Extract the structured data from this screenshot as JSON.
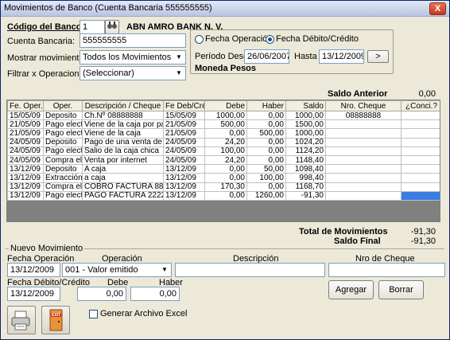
{
  "window": {
    "title": "Movimientos de Banco (Cuenta Bancaria 555555555)",
    "close_glyph": "X"
  },
  "filters": {
    "codigo_label": "Código del Banco:",
    "codigo_value": "1",
    "bank_name": "ABN AMRO BANK N. V.",
    "cuenta_label": "Cuenta Bancaria:",
    "cuenta_value": "555555555",
    "mostrar_label": "Mostrar movimientos:",
    "mostrar_value": "Todos los Movimientos",
    "filtrar_label": "Filtrar x Operacion:",
    "filtrar_value": "(Seleccionar)"
  },
  "period": {
    "radio_fecha_operacion": "Fecha Operación",
    "radio_fecha_debito": "Fecha Débito/Crédito",
    "selected_radio": "fecha_debito",
    "desde_label": "Período Desde",
    "desde_value": "26/06/2007",
    "hasta_label": "Hasta",
    "hasta_value": "13/12/2009",
    "go_label": ">",
    "moneda": "Moneda Pesos"
  },
  "saldo_anterior": {
    "label": "Saldo Anterior",
    "value": "0,00"
  },
  "table": {
    "columns": [
      "Fe. Oper.",
      "Oper.",
      "Descripción / Cheque",
      "Fe Deb/Cré",
      "Debe",
      "Haber",
      "Saldo",
      "Nro. Cheque",
      "¿Conci.?"
    ],
    "rows": [
      [
        "15/05/09",
        "Deposito",
        "Ch.Nº 08888888",
        "15/05/09",
        "1000,00",
        "0,00",
        "1000,00",
        "08888888",
        ""
      ],
      [
        "21/05/09",
        "Pago electró",
        "Viene de la caja por paso a",
        "21/05/09",
        "500,00",
        "0,00",
        "1500,00",
        "",
        ""
      ],
      [
        "21/05/09",
        "Pago electró",
        "Viene de la caja",
        "21/05/09",
        "0,00",
        "500,00",
        "1000,00",
        "",
        ""
      ],
      [
        "24/05/09",
        "Deposito",
        "Pago de una venta de una",
        "24/05/09",
        "24,20",
        "0,00",
        "1024,20",
        "",
        ""
      ],
      [
        "24/05/09",
        "Pago electró",
        "Salio de la caja chica",
        "24/05/09",
        "100,00",
        "0,00",
        "1124,20",
        "",
        ""
      ],
      [
        "24/05/09",
        "Compra elect",
        "Venta por internet",
        "24/05/09",
        "24,20",
        "0,00",
        "1148,40",
        "",
        ""
      ],
      [
        "13/12/09",
        "Deposito",
        "A caja",
        "13/12/09",
        "0,00",
        "50,00",
        "1098,40",
        "",
        ""
      ],
      [
        "13/12/09",
        "Extracción b",
        "a caja",
        "13/12/09",
        "0,00",
        "100,00",
        "998,40",
        "",
        ""
      ],
      [
        "13/12/09",
        "Compra elect",
        "COBRO FACTURA 8867",
        "13/12/09",
        "170,30",
        "0,00",
        "1168,70",
        "",
        ""
      ],
      [
        "13/12/09",
        "Pago electró",
        "PAGO FACTURA 222222",
        "13/12/09",
        "0,00",
        "1260,00",
        "-91,30",
        "",
        ""
      ]
    ]
  },
  "totals": {
    "total_label": "Total de Movimientos",
    "total_value": "-91,30",
    "saldo_label": "Saldo Final",
    "saldo_value": "-91,30"
  },
  "nuevo": {
    "group_label": "Nuevo Movimiento",
    "fecha_op_label": "Fecha Operación",
    "fecha_op_value": "13/12/2009",
    "operacion_label": "Operación",
    "operacion_value": "001 - Valor emitido",
    "descripcion_label": "Descripción",
    "descripcion_value": "",
    "cheque_label": "Nro de Cheque",
    "cheque_value": "",
    "fecha_deb_label": "Fecha Débito/Crédito",
    "fecha_deb_value": "13/12/2009",
    "debe_label": "Debe",
    "debe_value": "0,00",
    "haber_label": "Haber",
    "haber_value": "0,00",
    "agregar_label": "Agregar",
    "borrar_label": "Borrar"
  },
  "footer": {
    "generar_label": "Generar Archivo Excel",
    "exit_label": "EXIT"
  }
}
